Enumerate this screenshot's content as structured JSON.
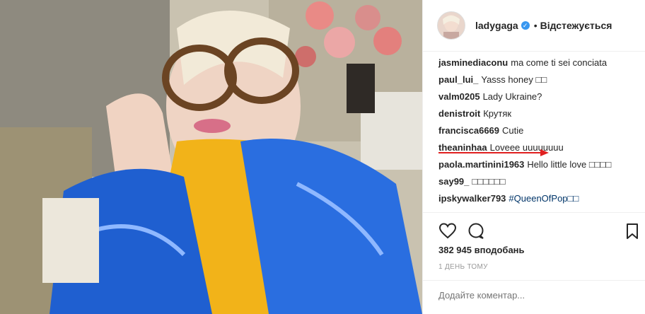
{
  "post": {
    "author": "ladygaga",
    "follow_status": "Відстежується",
    "dot": "•"
  },
  "comments": [
    {
      "user": "jasminediaconu",
      "text": "ma come ti sei conciata"
    },
    {
      "user": "paul_lui_",
      "text": "Yasss honey □□"
    },
    {
      "user": "valm0205",
      "text": "Lady Ukraine?"
    },
    {
      "user": "denistroit",
      "text": "Крутяк"
    },
    {
      "user": "francisca6669",
      "text": "Cutie"
    },
    {
      "user": "theaninhaa",
      "text": "Loveee uuuuuuuu"
    },
    {
      "user": "paola.martinini1963",
      "text": "Hello little love □□□□"
    },
    {
      "user": "say99_",
      "text": "□□□□□□"
    },
    {
      "user": "ipskywalker793",
      "text": "#QueenOfPop□□"
    }
  ],
  "likes": "382 945 вподобань",
  "time_ago": "1 ДЕНЬ ТОМУ",
  "add_comment_placeholder": "Додайте коментар...",
  "colors": {
    "link": "#003569",
    "verified": "#3897f0",
    "arrow": "#e02020"
  },
  "icons": {
    "verified": "verified-badge-icon",
    "like": "heart-icon",
    "comment": "comment-bubble-icon",
    "save": "bookmark-icon"
  }
}
